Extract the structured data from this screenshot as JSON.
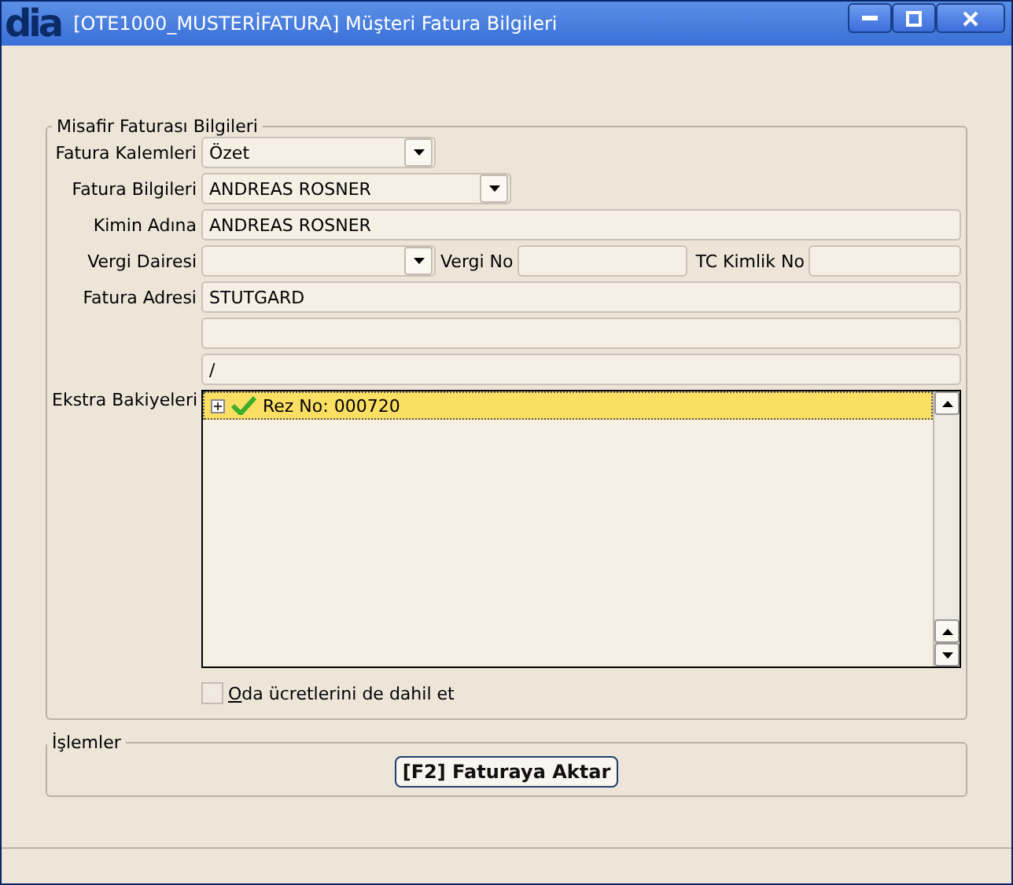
{
  "window": {
    "logo": "dia",
    "title": "[OTE1000_MUSTERİFATURA] Müşteri Fatura Bilgileri"
  },
  "guest_invoice": {
    "legend": "Misafir Faturası Bilgileri",
    "rows": [
      {
        "kind": "combo",
        "label": "Fatura Kalemleri",
        "value": "Özet"
      },
      {
        "kind": "combo",
        "label": "Fatura Bilgileri",
        "value": "ANDREAS ROSNER"
      },
      {
        "kind": "text",
        "label": "Kimin Adına",
        "value": "ANDREAS ROSNER"
      },
      {
        "kind": "tax",
        "label": "Vergi Dairesi",
        "tax_no_label": "Vergi No",
        "tc_label": "TC Kimlik No"
      },
      {
        "kind": "text",
        "label": "Fatura Adresi",
        "value": "STUTGARD"
      },
      {
        "kind": "text"
      },
      {
        "kind": "text",
        "value": "/"
      }
    ],
    "balances": {
      "label": "Ekstra Bakiyeleri",
      "items": [
        {
          "text": "Rez No: 000720",
          "checked": true,
          "expanded": false,
          "selected": true
        }
      ]
    },
    "include_room": {
      "label": "Oda ücretlerini de dahil et",
      "checked": false
    }
  },
  "actions": {
    "legend": "İşlemler",
    "button": "[F2] Faturaya Aktar"
  }
}
